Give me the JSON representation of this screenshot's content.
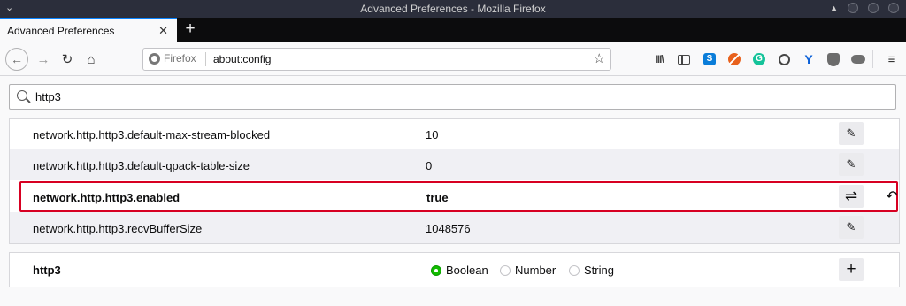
{
  "window": {
    "title": "Advanced Preferences - Mozilla Firefox"
  },
  "tabs": [
    {
      "label": "Advanced Preferences",
      "active": true
    }
  ],
  "navbar": {
    "identity_label": "Firefox",
    "url": "about:config"
  },
  "search": {
    "value": "http3"
  },
  "preferences": [
    {
      "name": "network.http.http3.default-max-stream-blocked",
      "value": "10",
      "modified": false,
      "action_icon": "pencil-icon"
    },
    {
      "name": "network.http.http3.default-qpack-table-size",
      "value": "0",
      "modified": false,
      "action_icon": "pencil-icon"
    },
    {
      "name": "network.http.http3.enabled",
      "value": "true",
      "modified": true,
      "action_icon": "toggle-arrows-icon"
    },
    {
      "name": "network.http.http3.recvBufferSize",
      "value": "1048576",
      "modified": false,
      "action_icon": "pencil-icon"
    }
  ],
  "new_pref": {
    "name": "http3",
    "types": [
      "Boolean",
      "Number",
      "String"
    ],
    "selected": "Boolean"
  },
  "colors": {
    "accent": "#0a84ff",
    "modified_border": "#d70022",
    "radio_checked": "#12bc00"
  }
}
